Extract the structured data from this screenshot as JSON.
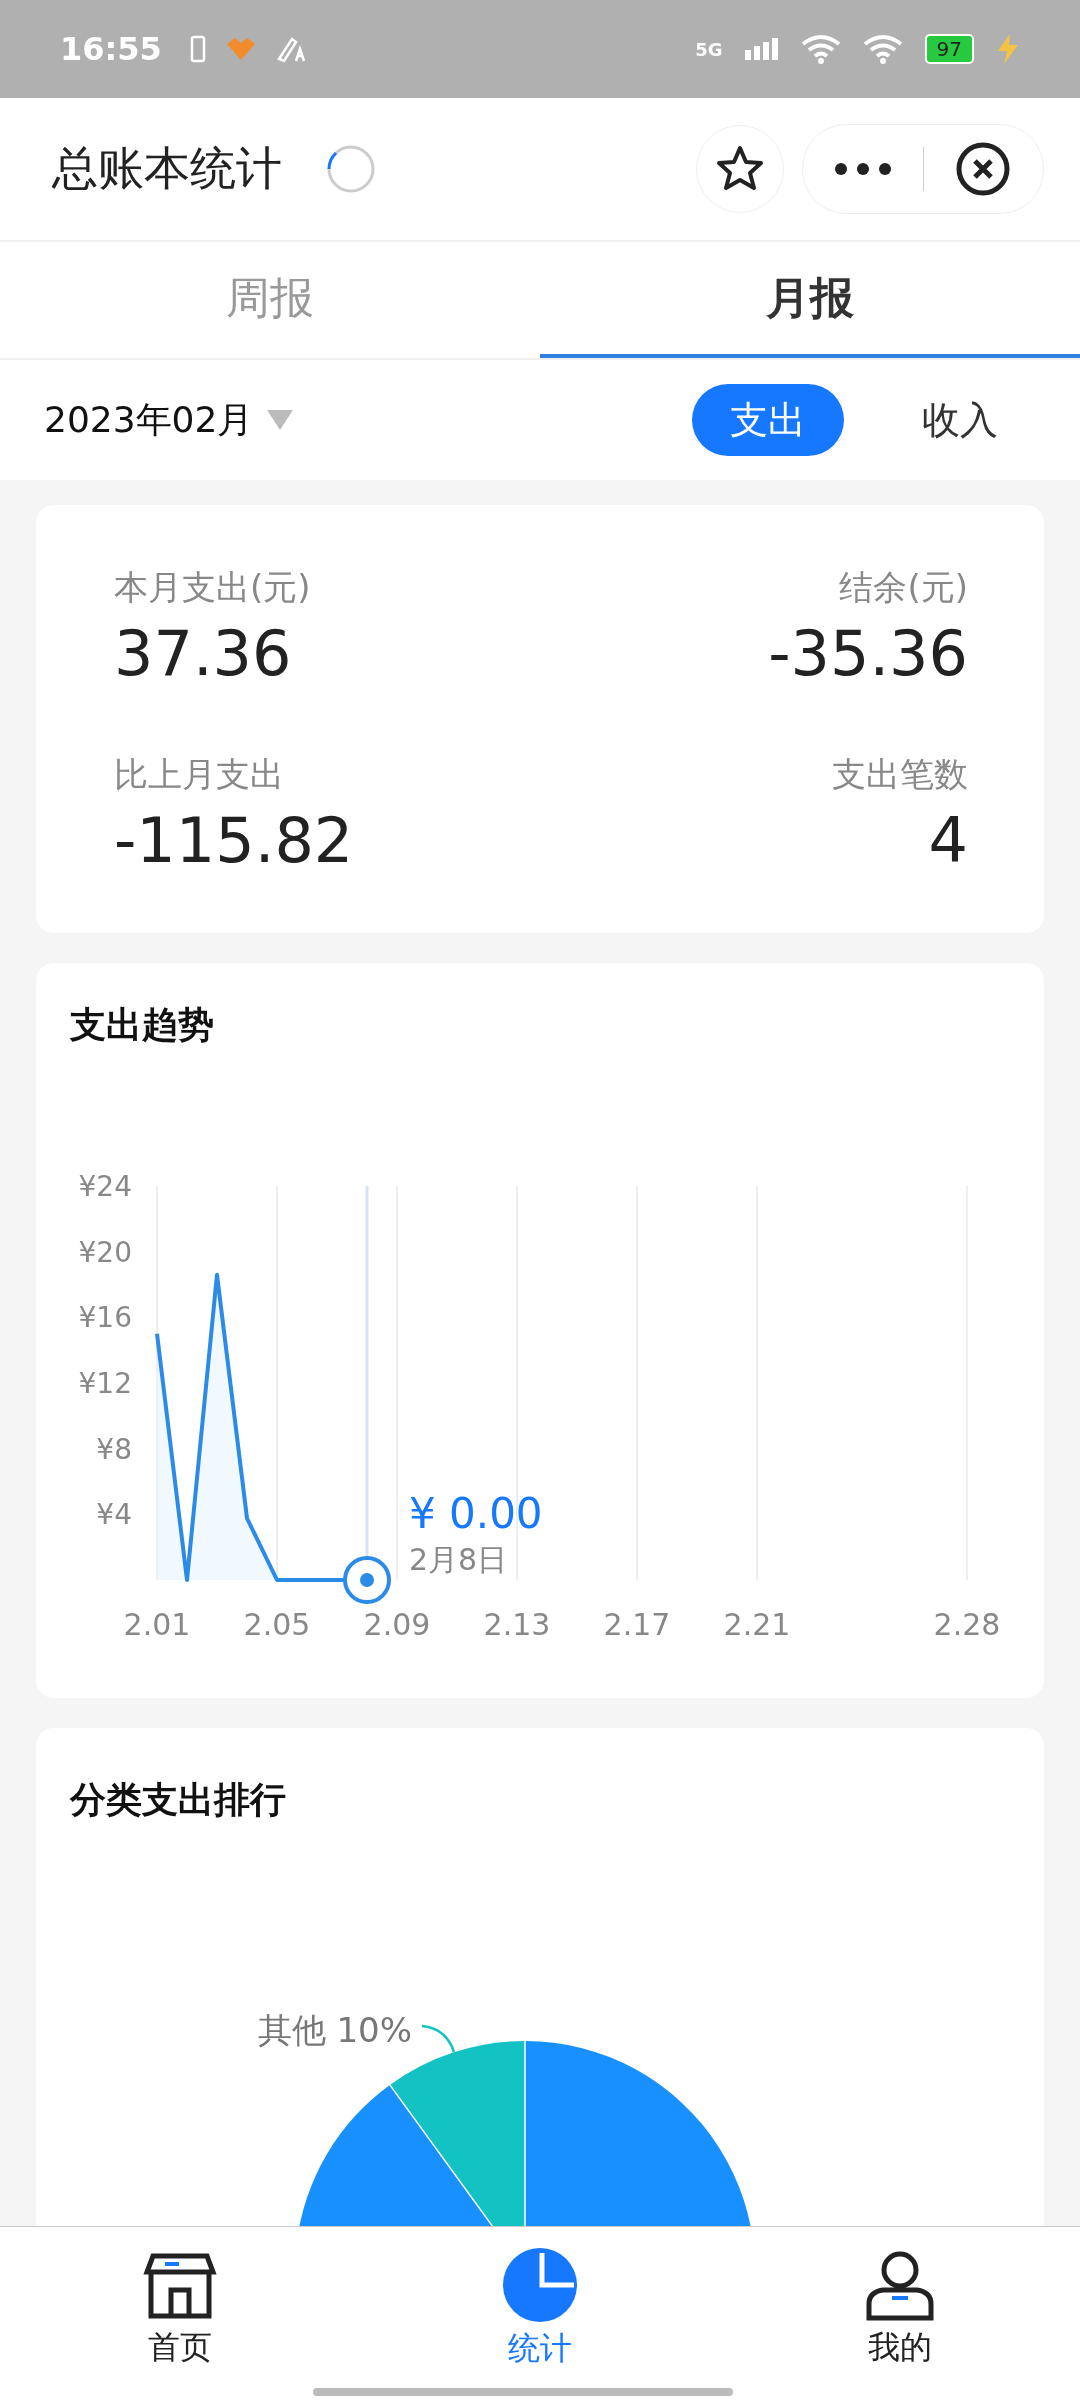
{
  "status_bar": {
    "time": "16:55",
    "network": "5G",
    "battery": "97"
  },
  "header": {
    "title": "总账本统计"
  },
  "tabs": [
    {
      "label": "周报",
      "selected": false
    },
    {
      "label": "月报",
      "selected": true
    }
  ],
  "filter": {
    "month": "2023年02月",
    "types": [
      {
        "label": "支出",
        "selected": true
      },
      {
        "label": "收入",
        "selected": false
      }
    ]
  },
  "summary": [
    {
      "label": "本月支出(元)",
      "value": "37.36"
    },
    {
      "label": "结余(元)",
      "value": "-35.36"
    },
    {
      "label": "比上月支出",
      "value": "-115.82"
    },
    {
      "label": "支出笔数",
      "value": "4"
    }
  ],
  "trend": {
    "title": "支出趋势",
    "tooltip": {
      "value": "¥ 0.00",
      "date": "2月8日"
    },
    "chart_data": {
      "type": "line",
      "x": [
        2.01,
        2.02,
        2.03,
        2.04,
        2.05,
        2.06,
        2.07,
        2.08
      ],
      "series": [
        {
          "color": "#2b8be6",
          "values": [
            15.0,
            0,
            18.6,
            3.76,
            0,
            0,
            0,
            0
          ]
        }
      ],
      "xlim": [
        2.01,
        2.28
      ],
      "ylim": [
        0,
        24
      ],
      "grid": true,
      "ref_lines": [
        {
          "axis": "x",
          "value": 2.08,
          "color": "#d5e3fb"
        }
      ],
      "xticks": [
        2.01,
        2.05,
        2.09,
        2.13,
        2.17,
        2.21,
        2.28
      ],
      "yticks": [
        {
          "value": 4,
          "label": "¥4"
        },
        {
          "value": 8,
          "label": "¥8"
        },
        {
          "value": 12,
          "label": "¥12"
        },
        {
          "value": 16,
          "label": "¥16"
        },
        {
          "value": 20,
          "label": "¥20"
        },
        {
          "value": 24,
          "label": "¥24"
        }
      ]
    }
  },
  "ranking": {
    "title": "分类支出排行",
    "slice_label": "其他 10%"
  },
  "nav": [
    {
      "label": "首页",
      "selected": false
    },
    {
      "label": "统计",
      "selected": true
    },
    {
      "label": "我的",
      "selected": false
    }
  ]
}
